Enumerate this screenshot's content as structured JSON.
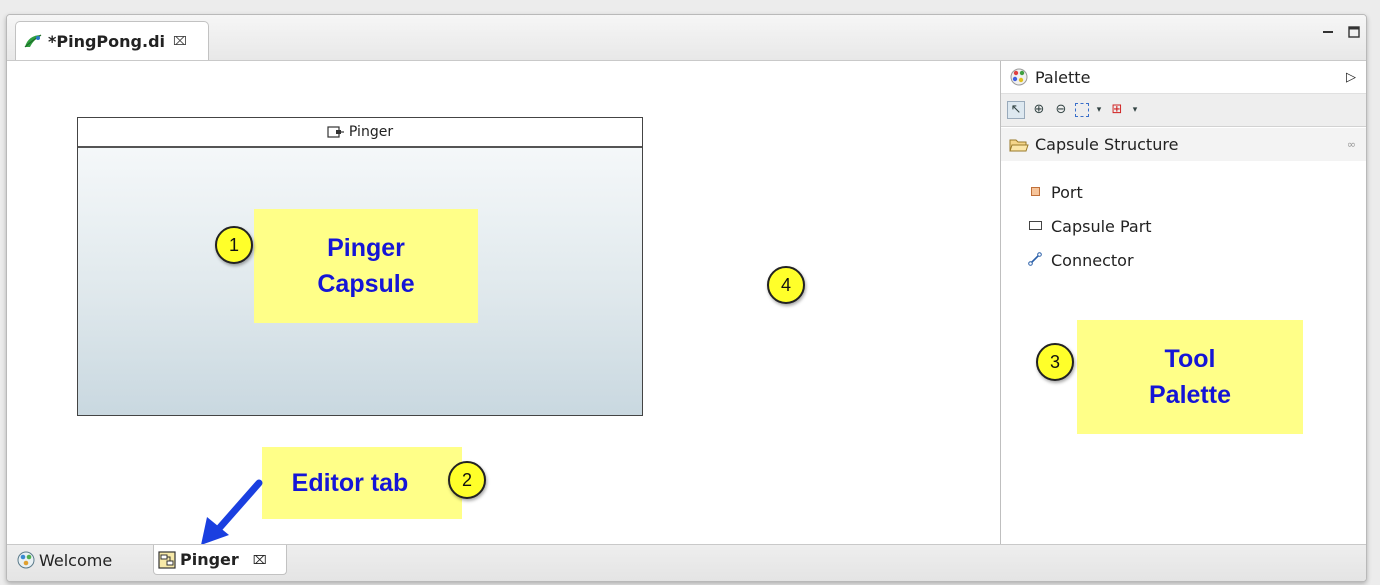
{
  "editor": {
    "tab_title": "*PingPong.di",
    "tab_close": "⌧",
    "minimize": "▭",
    "maximize": "▢"
  },
  "canvas": {
    "capsule_name": "Pinger"
  },
  "palette": {
    "title": "Palette",
    "drawer_label": "Capsule Structure",
    "items": [
      {
        "label": "Port",
        "icon": "port-icon"
      },
      {
        "label": "Capsule Part",
        "icon": "capsule-part-icon"
      },
      {
        "label": "Connector",
        "icon": "connector-icon"
      }
    ]
  },
  "bottom_tabs": [
    {
      "label": "Welcome",
      "icon": "welcome-icon"
    },
    {
      "label": "Pinger",
      "icon": "diagram-icon",
      "close": "⌧"
    }
  ],
  "annotations": {
    "callout_1": [
      "Pinger",
      "Capsule"
    ],
    "callout_2": "Editor tab",
    "callout_3": [
      "Tool",
      "Palette"
    ],
    "badge_1": "1",
    "badge_2": "2",
    "badge_3": "3",
    "badge_4": "4",
    "color_callout_bg": "#ffff88",
    "color_callout_text": "#1515d6",
    "color_badge": "#ffff2a",
    "color_arrow": "#1a3fe0"
  }
}
